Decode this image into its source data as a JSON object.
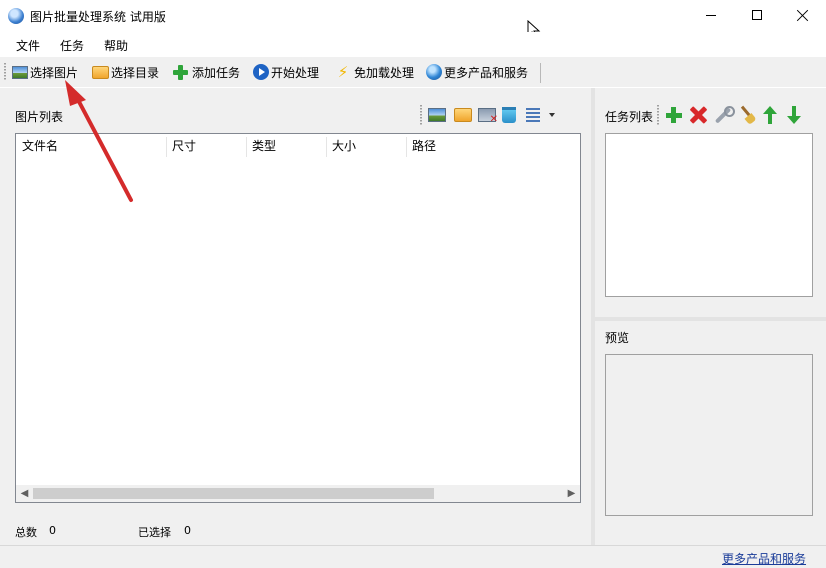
{
  "window": {
    "title": "图片批量处理系统 试用版"
  },
  "menu": {
    "items": [
      "文件",
      "任务",
      "帮助"
    ]
  },
  "toolbar": {
    "buttons": [
      {
        "label": "选择图片",
        "icon": "picture-icon"
      },
      {
        "label": "选择目录",
        "icon": "folder-icon"
      },
      {
        "label": "添加任务",
        "icon": "plus-icon"
      },
      {
        "label": "开始处理",
        "icon": "play-icon"
      },
      {
        "label": "免加载处理",
        "icon": "lightning-icon"
      },
      {
        "label": "更多产品和服务",
        "icon": "globe-icon"
      }
    ]
  },
  "image_list": {
    "title": "图片列表",
    "columns": [
      "文件名",
      "尺寸",
      "类型",
      "大小",
      "路径"
    ],
    "rows": []
  },
  "status": {
    "total_label": "总数",
    "total_value": "0",
    "selected_label": "已选择",
    "selected_value": "0"
  },
  "task_list": {
    "title": "任务列表"
  },
  "preview": {
    "title": "预览"
  },
  "footer": {
    "more_link": "更多产品和服务"
  },
  "colors": {
    "accent_arrow": "#d42b2b",
    "link": "#1a3c99",
    "panel_bg": "#f0f0f0"
  }
}
